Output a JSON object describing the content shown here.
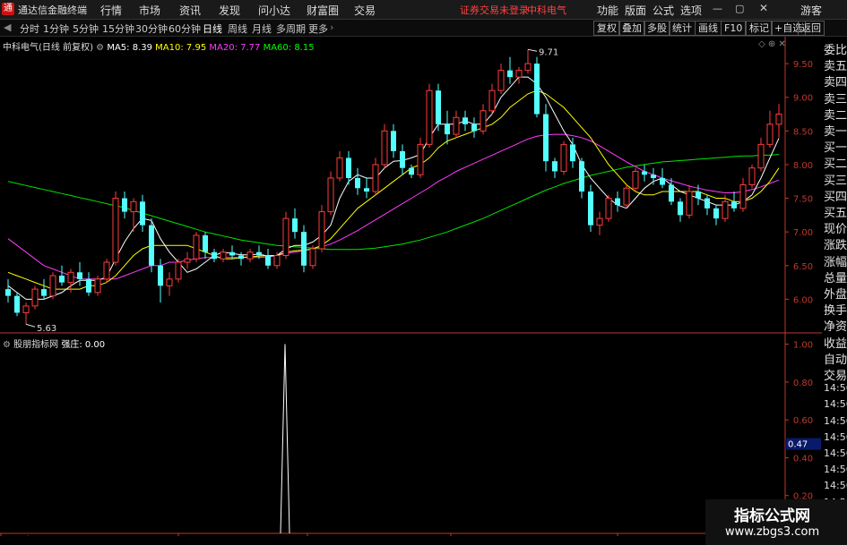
{
  "app": {
    "title": "通达信金融终端",
    "logo": "TDX"
  },
  "menus": [
    "行情",
    "市场",
    "资讯",
    "发现",
    "问小达",
    "财富圈",
    "交易"
  ],
  "warning": "证券交易未登录",
  "stock_name_top": "中科电气",
  "top_right_menus": [
    "功能",
    "版面",
    "公式",
    "选项"
  ],
  "user": "游客",
  "periods": [
    "分时",
    "1分钟",
    "5分钟",
    "15分钟",
    "30分钟",
    "60分钟",
    "日线",
    "周线",
    "月线",
    "多周期",
    "更多"
  ],
  "active_period": "日线",
  "toolbar_buttons": [
    "复权",
    "叠加",
    "多股",
    "统计",
    "画线",
    "F10",
    "标记",
    "+自选",
    "返回"
  ],
  "main_legend": {
    "name": "中科电气(日线 前复权)",
    "ma5": "MA5: 8.39",
    "ma10": "MA10: 7.95",
    "ma20": "MA20: 7.77",
    "ma60": "MA60: 8.15"
  },
  "sub_legend": {
    "name": "股朋指标网",
    "field": "强庄: 0.00"
  },
  "main_y_ticks": [
    "9.50",
    "9.00",
    "8.50",
    "8.00",
    "7.50",
    "7.00",
    "6.50",
    "6.00"
  ],
  "sub_y_ticks": [
    "1.00",
    "0.80",
    "0.60",
    "0.40",
    "0.20"
  ],
  "sub_current": "0.47",
  "high_label": "9.71",
  "low_label": "5.63",
  "x_labels": [
    "2020年",
    "5",
    "6",
    "7",
    "8"
  ],
  "right_panel": [
    "委比",
    "卖五",
    "卖四",
    "卖三",
    "卖二",
    "卖一",
    "买一",
    "买二",
    "买三",
    "买四",
    "买五",
    "现价",
    "涨跌",
    "涨幅",
    "总量",
    "外盘",
    "换手",
    "净资",
    "收益",
    "自动",
    "交易",
    "14:56",
    "14:56",
    "14:56",
    "14:56",
    "14:56",
    "14:56",
    "14:56",
    "14:56",
    "14:56"
  ],
  "watermark": {
    "line1": "指标公式网",
    "line2": "www.zbgs3.com"
  },
  "colors": {
    "up": "#ff3c3c",
    "down": "#54ffff",
    "ma5": "#ffffff",
    "ma10": "#ffff00",
    "ma20": "#ff3cff",
    "ma60": "#00e600",
    "axis": "#c0392b"
  },
  "chart_data": {
    "type": "candlestick",
    "ohlc": [
      [
        6.15,
        6.3,
        5.95,
        6.05
      ],
      [
        6.05,
        6.1,
        5.75,
        5.8
      ],
      [
        5.8,
        5.95,
        5.63,
        5.9
      ],
      [
        5.9,
        6.2,
        5.85,
        6.15
      ],
      [
        6.15,
        6.3,
        6.0,
        6.05
      ],
      [
        6.05,
        6.4,
        6.0,
        6.35
      ],
      [
        6.35,
        6.5,
        6.2,
        6.25
      ],
      [
        6.25,
        6.45,
        6.1,
        6.4
      ],
      [
        6.4,
        6.55,
        6.2,
        6.3
      ],
      [
        6.3,
        6.4,
        6.05,
        6.1
      ],
      [
        6.1,
        6.35,
        6.05,
        6.3
      ],
      [
        6.3,
        6.6,
        6.25,
        6.55
      ],
      [
        6.55,
        7.6,
        6.5,
        7.5
      ],
      [
        7.5,
        7.6,
        7.2,
        7.3
      ],
      [
        7.3,
        7.5,
        7.0,
        7.45
      ],
      [
        7.45,
        7.55,
        7.0,
        7.1
      ],
      [
        7.1,
        7.2,
        6.4,
        6.5
      ],
      [
        6.5,
        6.6,
        5.95,
        6.2
      ],
      [
        6.2,
        6.4,
        6.05,
        6.3
      ],
      [
        6.3,
        6.6,
        6.25,
        6.55
      ],
      [
        6.55,
        6.7,
        6.45,
        6.6
      ],
      [
        6.6,
        7.0,
        6.55,
        6.95
      ],
      [
        6.95,
        7.0,
        6.6,
        6.7
      ],
      [
        6.7,
        6.75,
        6.55,
        6.6
      ],
      [
        6.6,
        6.75,
        6.55,
        6.7
      ],
      [
        6.7,
        6.8,
        6.6,
        6.65
      ],
      [
        6.65,
        6.7,
        6.5,
        6.6
      ],
      [
        6.6,
        6.75,
        6.55,
        6.7
      ],
      [
        6.7,
        6.8,
        6.6,
        6.65
      ],
      [
        6.65,
        6.75,
        6.45,
        6.5
      ],
      [
        6.5,
        6.7,
        6.45,
        6.65
      ],
      [
        6.65,
        7.3,
        6.6,
        7.2
      ],
      [
        7.2,
        7.35,
        6.9,
        7.0
      ],
      [
        7.0,
        7.1,
        6.4,
        6.5
      ],
      [
        6.5,
        6.8,
        6.45,
        6.75
      ],
      [
        6.75,
        7.4,
        6.7,
        7.3
      ],
      [
        7.3,
        7.9,
        7.25,
        7.8
      ],
      [
        7.8,
        8.2,
        7.75,
        8.1
      ],
      [
        8.1,
        8.2,
        7.7,
        7.8
      ],
      [
        7.8,
        7.95,
        7.55,
        7.65
      ],
      [
        7.65,
        7.8,
        7.5,
        7.6
      ],
      [
        7.6,
        8.1,
        7.55,
        8.0
      ],
      [
        8.0,
        8.6,
        7.95,
        8.5
      ],
      [
        8.5,
        8.6,
        8.1,
        8.2
      ],
      [
        8.2,
        8.3,
        7.85,
        7.95
      ],
      [
        7.95,
        8.0,
        7.8,
        7.85
      ],
      [
        7.85,
        8.4,
        7.8,
        8.3
      ],
      [
        8.3,
        9.2,
        8.25,
        9.1
      ],
      [
        9.1,
        9.2,
        8.5,
        8.6
      ],
      [
        8.6,
        8.8,
        8.3,
        8.45
      ],
      [
        8.45,
        8.8,
        8.4,
        8.7
      ],
      [
        8.7,
        8.8,
        8.5,
        8.6
      ],
      [
        8.6,
        8.7,
        8.4,
        8.5
      ],
      [
        8.5,
        8.9,
        8.45,
        8.8
      ],
      [
        8.8,
        9.2,
        8.75,
        9.1
      ],
      [
        9.1,
        9.5,
        9.05,
        9.4
      ],
      [
        9.4,
        9.6,
        9.2,
        9.3
      ],
      [
        9.3,
        9.45,
        9.2,
        9.4
      ],
      [
        9.4,
        9.71,
        9.35,
        9.5
      ],
      [
        9.5,
        9.6,
        8.7,
        8.75
      ],
      [
        8.75,
        8.9,
        7.9,
        8.05
      ],
      [
        8.05,
        8.1,
        7.8,
        7.9
      ],
      [
        7.9,
        8.35,
        7.85,
        8.3
      ],
      [
        8.3,
        8.4,
        7.95,
        8.05
      ],
      [
        8.05,
        8.1,
        7.5,
        7.6
      ],
      [
        7.6,
        7.7,
        7.0,
        7.1
      ],
      [
        7.1,
        7.3,
        6.95,
        7.2
      ],
      [
        7.2,
        7.55,
        7.15,
        7.5
      ],
      [
        7.5,
        7.6,
        7.3,
        7.4
      ],
      [
        7.4,
        7.7,
        7.35,
        7.65
      ],
      [
        7.65,
        7.95,
        7.6,
        7.9
      ],
      [
        7.9,
        8.0,
        7.75,
        7.85
      ],
      [
        7.85,
        7.95,
        7.7,
        7.8
      ],
      [
        7.8,
        7.95,
        7.65,
        7.7
      ],
      [
        7.7,
        7.8,
        7.4,
        7.45
      ],
      [
        7.45,
        7.5,
        7.15,
        7.25
      ],
      [
        7.25,
        7.7,
        7.2,
        7.6
      ],
      [
        7.6,
        7.7,
        7.4,
        7.5
      ],
      [
        7.5,
        7.55,
        7.25,
        7.35
      ],
      [
        7.35,
        7.4,
        7.1,
        7.2
      ],
      [
        7.2,
        7.55,
        7.15,
        7.45
      ],
      [
        7.45,
        7.6,
        7.3,
        7.35
      ],
      [
        7.35,
        7.8,
        7.3,
        7.7
      ],
      [
        7.7,
        8.0,
        7.65,
        7.95
      ],
      [
        7.95,
        8.4,
        7.9,
        8.3
      ],
      [
        8.3,
        8.8,
        8.25,
        8.6
      ],
      [
        8.6,
        8.9,
        8.4,
        8.75
      ]
    ],
    "ma5": [
      6.2,
      6.1,
      6.0,
      6.0,
      6.0,
      6.05,
      6.1,
      6.2,
      6.28,
      6.28,
      6.28,
      6.33,
      6.6,
      6.85,
      7.05,
      7.2,
      7.17,
      6.9,
      6.7,
      6.55,
      6.4,
      6.45,
      6.55,
      6.65,
      6.7,
      6.68,
      6.66,
      6.66,
      6.67,
      6.64,
      6.65,
      6.75,
      6.8,
      6.8,
      6.85,
      6.95,
      7.1,
      7.5,
      7.75,
      7.85,
      7.8,
      7.8,
      7.95,
      8.05,
      8.06,
      8.1,
      8.15,
      8.4,
      8.6,
      8.6,
      8.6,
      8.65,
      8.6,
      8.6,
      8.75,
      9.0,
      9.15,
      9.3,
      9.3,
      9.2,
      9.0,
      8.75,
      8.5,
      8.3,
      8.0,
      7.8,
      7.65,
      7.5,
      7.4,
      7.35,
      7.5,
      7.65,
      7.75,
      7.8,
      7.7,
      7.6,
      7.55,
      7.5,
      7.45,
      7.4,
      7.4,
      7.4,
      7.45,
      7.55,
      7.8,
      8.1,
      8.39
    ],
    "ma10": [
      6.4,
      6.35,
      6.3,
      6.25,
      6.2,
      6.15,
      6.15,
      6.15,
      6.15,
      6.2,
      6.2,
      6.25,
      6.35,
      6.5,
      6.65,
      6.75,
      6.8,
      6.8,
      6.8,
      6.8,
      6.8,
      6.75,
      6.7,
      6.65,
      6.6,
      6.6,
      6.62,
      6.63,
      6.64,
      6.65,
      6.65,
      6.7,
      6.72,
      6.73,
      6.75,
      6.8,
      6.9,
      7.05,
      7.2,
      7.35,
      7.45,
      7.55,
      7.65,
      7.75,
      7.85,
      7.95,
      8.0,
      8.1,
      8.25,
      8.35,
      8.4,
      8.45,
      8.5,
      8.55,
      8.6,
      8.7,
      8.85,
      8.95,
      9.05,
      9.1,
      9.05,
      8.95,
      8.85,
      8.7,
      8.55,
      8.4,
      8.2,
      8.0,
      7.85,
      7.7,
      7.6,
      7.55,
      7.55,
      7.6,
      7.6,
      7.6,
      7.6,
      7.6,
      7.55,
      7.5,
      7.5,
      7.45,
      7.45,
      7.5,
      7.6,
      7.75,
      7.95
    ],
    "ma20": [
      6.9,
      6.8,
      6.7,
      6.6,
      6.5,
      6.45,
      6.4,
      6.35,
      6.3,
      6.3,
      6.3,
      6.3,
      6.3,
      6.35,
      6.4,
      6.45,
      6.5,
      6.5,
      6.55,
      6.55,
      6.58,
      6.6,
      6.62,
      6.62,
      6.62,
      6.62,
      6.62,
      6.62,
      6.62,
      6.63,
      6.65,
      6.68,
      6.7,
      6.72,
      6.75,
      6.78,
      6.82,
      6.88,
      6.95,
      7.02,
      7.1,
      7.18,
      7.26,
      7.34,
      7.42,
      7.5,
      7.58,
      7.66,
      7.75,
      7.82,
      7.9,
      7.96,
      8.02,
      8.08,
      8.14,
      8.2,
      8.26,
      8.32,
      8.38,
      8.42,
      8.44,
      8.45,
      8.45,
      8.43,
      8.4,
      8.35,
      8.28,
      8.2,
      8.12,
      8.04,
      7.97,
      7.9,
      7.85,
      7.8,
      7.76,
      7.72,
      7.68,
      7.65,
      7.62,
      7.6,
      7.58,
      7.58,
      7.6,
      7.63,
      7.67,
      7.72,
      7.77
    ],
    "ma60": [
      7.75,
      7.72,
      7.69,
      7.66,
      7.63,
      7.6,
      7.57,
      7.54,
      7.51,
      7.48,
      7.45,
      7.42,
      7.39,
      7.36,
      7.32,
      7.28,
      7.24,
      7.2,
      7.16,
      7.12,
      7.08,
      7.04,
      7.0,
      6.97,
      6.94,
      6.91,
      6.88,
      6.86,
      6.84,
      6.82,
      6.8,
      6.79,
      6.78,
      6.77,
      6.76,
      6.75,
      6.74,
      6.74,
      6.74,
      6.74,
      6.75,
      6.76,
      6.78,
      6.8,
      6.82,
      6.85,
      6.88,
      6.92,
      6.96,
      7.0,
      7.05,
      7.1,
      7.15,
      7.2,
      7.26,
      7.32,
      7.38,
      7.44,
      7.5,
      7.56,
      7.62,
      7.67,
      7.72,
      7.76,
      7.8,
      7.84,
      7.87,
      7.9,
      7.93,
      7.96,
      7.98,
      8.0,
      8.02,
      8.04,
      8.05,
      8.06,
      8.07,
      8.08,
      8.09,
      8.1,
      8.11,
      8.12,
      8.13,
      8.13,
      8.14,
      8.14,
      8.15
    ],
    "ylim": [
      5.5,
      9.9
    ],
    "indicator": {
      "name": "强庄",
      "values_spike_index": 36,
      "spike_value": 1.0,
      "ylim": [
        0,
        1.05
      ]
    }
  }
}
